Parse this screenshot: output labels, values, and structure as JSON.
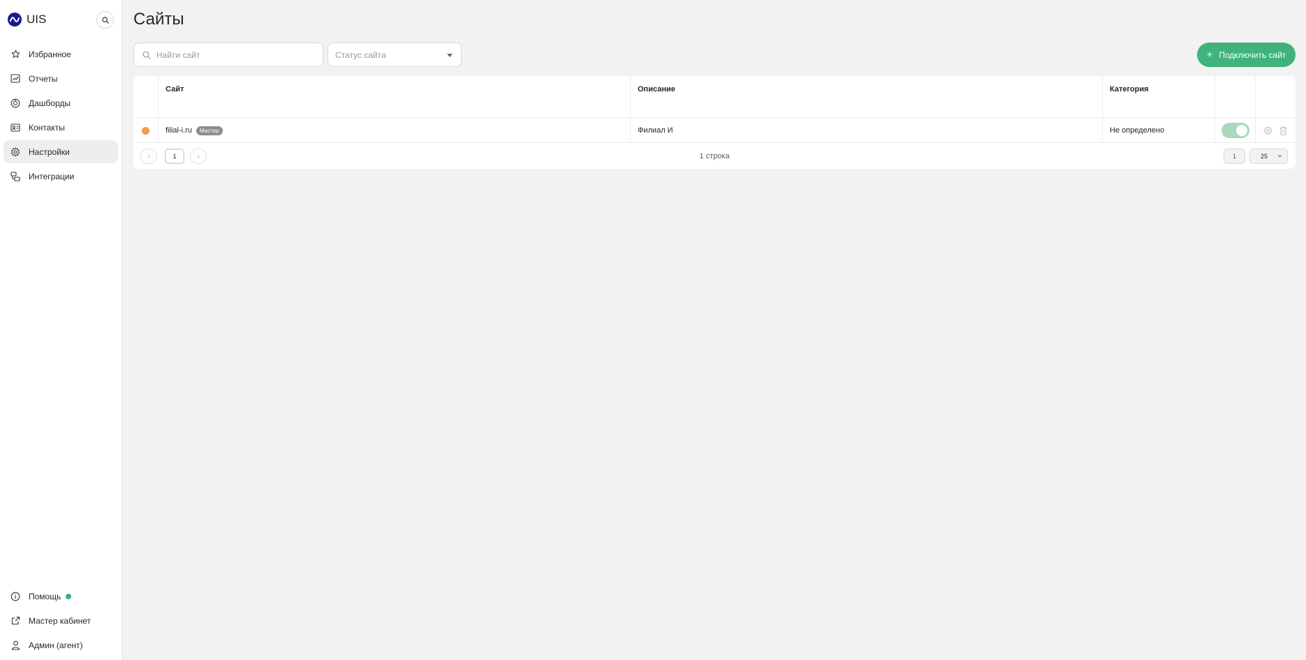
{
  "app": {
    "brand": "UIS"
  },
  "sidebar": {
    "items": [
      {
        "label": "Избранное",
        "icon": "star-icon"
      },
      {
        "label": "Отчеты",
        "icon": "reports-icon"
      },
      {
        "label": "Дашборды",
        "icon": "dashboard-icon"
      },
      {
        "label": "Контакты",
        "icon": "contacts-icon"
      },
      {
        "label": "Настройки",
        "icon": "gear-icon",
        "active": true
      },
      {
        "label": "Интеграции",
        "icon": "integrations-icon"
      }
    ],
    "bottom": [
      {
        "label": "Помощь",
        "icon": "info-icon"
      },
      {
        "label": "Мастер кабинет",
        "icon": "external-link-icon"
      },
      {
        "label": "Админ (агент)",
        "icon": "user-icon"
      }
    ]
  },
  "page": {
    "title": "Сайты"
  },
  "toolbar": {
    "search_placeholder": "Найти сайт",
    "status_placeholder": "Статус сайта",
    "add_label": "Подключить сайт"
  },
  "table": {
    "columns": [
      "Сайт",
      "Описание",
      "Категория"
    ],
    "rows": [
      {
        "site": "filial-i.ru",
        "badge": "Мастер",
        "description": "Филиал И",
        "category": "Не определено",
        "status_color": "#f39c45",
        "enabled": true
      }
    ],
    "footer": {
      "current_page": "1",
      "row_count": "1 строка",
      "page_input": "1",
      "page_size": "25"
    }
  },
  "colors": {
    "accent": "#3fb37a",
    "brand": "#1a1a8c",
    "status_pending": "#f39c45"
  }
}
